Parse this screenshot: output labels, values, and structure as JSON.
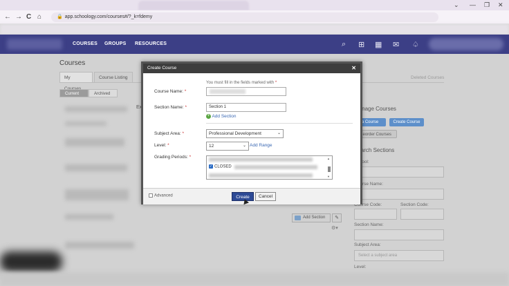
{
  "browser": {
    "url": "app.schoology.com/courses#/?_k=fdemy",
    "back_icon": "←",
    "forward_icon": "→",
    "reload_icon": "C",
    "home_icon": "⌂",
    "min_icon": "—",
    "max_icon": "❐",
    "close_icon": "✕",
    "chev_icon": "⌄"
  },
  "nav": {
    "links": [
      "COURSES",
      "GROUPS",
      "RESOURCES"
    ]
  },
  "page": {
    "title": "Courses",
    "tabs": [
      "My Courses",
      "Course Listing"
    ],
    "deleted": "Deleted Courses",
    "seg_current": "Current",
    "seg_archived": "Archived",
    "sidebar": {
      "manage_heading": "Manage Courses",
      "join_btn": "a Course",
      "create_btn": "Create Course",
      "reorder_btn": "Reorder Courses",
      "search_heading": "Search Sections",
      "school_label": "School:",
      "course_name_label": "Course Name:",
      "course_code_label": "Course Code:",
      "section_code_label": "Section Code:",
      "section_name_label": "Section Name:",
      "subject_area_label": "Subject Area:",
      "subject_placeholder": "Select a subject area",
      "level_label": "Level:"
    },
    "add_section_btn": "Add Section",
    "partial_text": "Ex"
  },
  "modal": {
    "title": "Create Course",
    "close": "✕",
    "required_note": "You must fill in the fields marked with",
    "star": "*",
    "course_name_label": "Course Name:",
    "section_name_label": "Section Name:",
    "section_name_value": "Section 1",
    "add_section_link": "Add Section",
    "subject_area_label": "Subject Area:",
    "subject_area_value": "Professional Development",
    "level_label": "Level:",
    "level_value": "12",
    "add_range_link": "Add Range",
    "grading_periods_label": "Grading Periods:",
    "grading_closed": "CLOSED",
    "advanced_label": "Advanced",
    "create_btn": "Create",
    "cancel_btn": "Cancel"
  }
}
